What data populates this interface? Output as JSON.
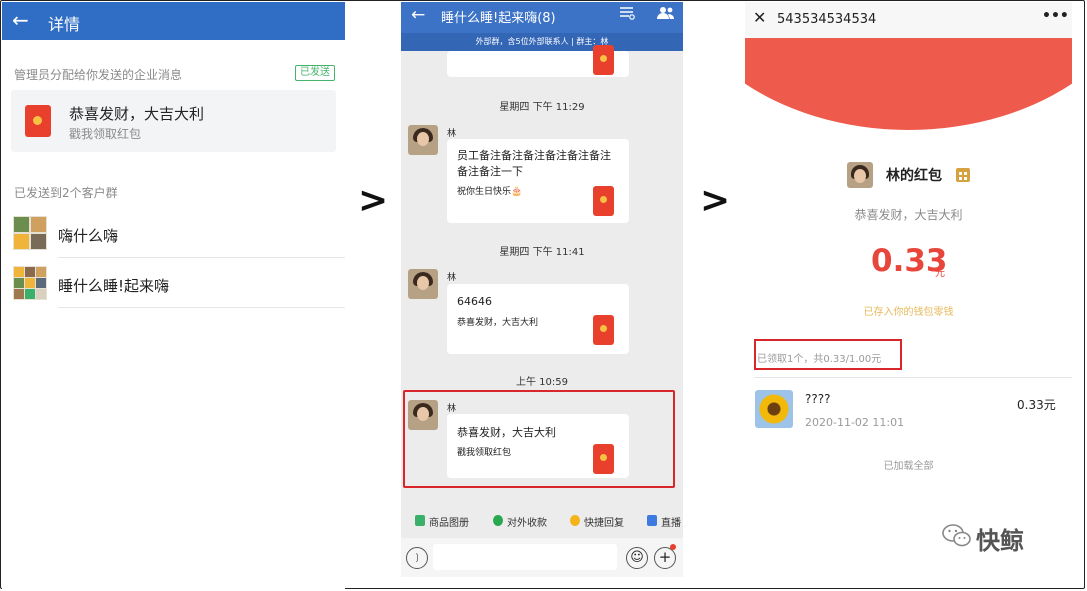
{
  "panel1": {
    "header_title": "详情",
    "section_label": "管理员分配给你发送的企业消息",
    "status_badge": "已发送",
    "message": {
      "title": "恭喜发财，大吉大利",
      "subtitle": "戳我领取红包"
    },
    "groups_label": "已发送到2个客户群",
    "groups": [
      {
        "name": "嗨什么嗨"
      },
      {
        "name": "睡什么睡!起来嗨"
      }
    ]
  },
  "separators": [
    ">",
    ">"
  ],
  "panel2": {
    "header_title": "睡什么睡!起来嗨(8)",
    "banner": "外部群，含5位外部联系人 | 群主：林",
    "messages": [
      {
        "timestamp": "星期四  下午 11:29",
        "sender": "林",
        "title": "员工备注备注备注备注备注备注备注备注一下",
        "subtitle": "祝你生日快乐🎂"
      },
      {
        "timestamp": "星期四  下午 11:41",
        "sender": "林",
        "title": "64646",
        "subtitle": "恭喜发财，大吉大利"
      },
      {
        "timestamp": "上午 10:59",
        "sender": "林",
        "title": "恭喜发财，大吉大利",
        "subtitle": "戳我领取红包"
      }
    ],
    "toolbar": [
      {
        "label": "商品图册",
        "color": "#3bb06a"
      },
      {
        "label": "对外收款",
        "color": "#2aa84f"
      },
      {
        "label": "快捷回复",
        "color": "#f3b41a"
      },
      {
        "label": "直播",
        "color": "#3d7be0"
      }
    ]
  },
  "panel3": {
    "header_title": "543534534534",
    "sender_line": "林的红包",
    "wish": "恭喜发财，大吉大利",
    "amount": "0.33",
    "amount_unit": "元",
    "saved_note": "已存入你的钱包零钱",
    "received_summary": "已领取1个，共0.33/1.00元",
    "records": [
      {
        "name": "????",
        "time": "2020-11-02 11:01",
        "amount": "0.33元"
      }
    ],
    "loaded_all": "已加载全部"
  },
  "watermark": "快鲸",
  "colors": {
    "header_blue": "#2f6ec4",
    "red_packet": "#e8402c",
    "red_arc": "#ee5a4b",
    "amount_red": "#e8463a",
    "highlight_red": "#d9262b",
    "badge_green": "#46b36b"
  }
}
